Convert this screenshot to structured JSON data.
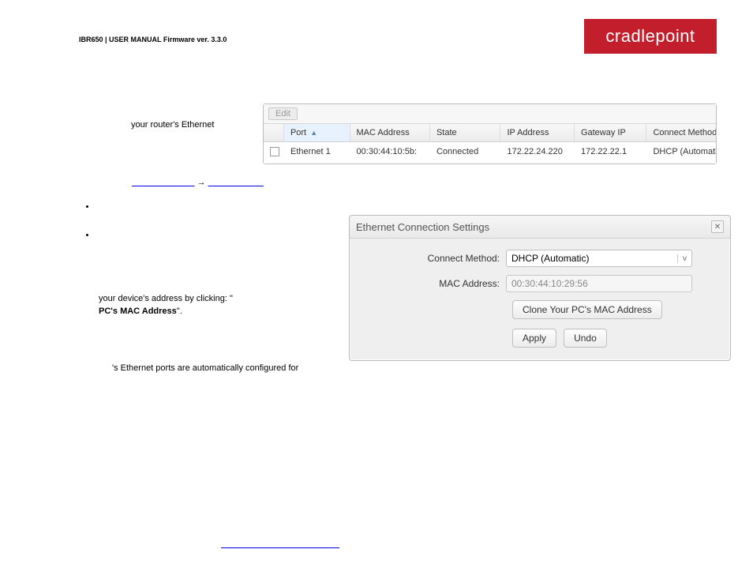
{
  "header": {
    "breadcrumb": "IBR650 | USER MANUAL Firmware ver. 3.3.0"
  },
  "brand": "cradlepoint",
  "body": {
    "line1": "your router's Ethernet",
    "arrow": "→",
    "addr_line1": "your device's address by clicking: \"",
    "addr_bold": "PC's MAC Address",
    "addr_tail": "\".",
    "footer": "'s Ethernet ports are automatically configured for"
  },
  "table": {
    "edit_label": "Edit",
    "columns": {
      "port": "Port",
      "mac": "MAC Address",
      "state": "State",
      "ip": "IP Address",
      "gw": "Gateway IP",
      "method": "Connect Method"
    },
    "row": {
      "port": "Ethernet 1",
      "mac": "00:30:44:10:5b:",
      "state": "Connected",
      "ip": "172.22.24.220",
      "gw": "172.22.22.1",
      "method": "DHCP (Automatic"
    }
  },
  "dialog": {
    "title": "Ethernet Connection Settings",
    "connect_label": "Connect Method:",
    "connect_value": "DHCP (Automatic)",
    "mac_label": "MAC Address:",
    "mac_value": "00:30:44:10:29:56",
    "clone_btn": "Clone Your PC's MAC Address",
    "apply": "Apply",
    "undo": "Undo"
  }
}
